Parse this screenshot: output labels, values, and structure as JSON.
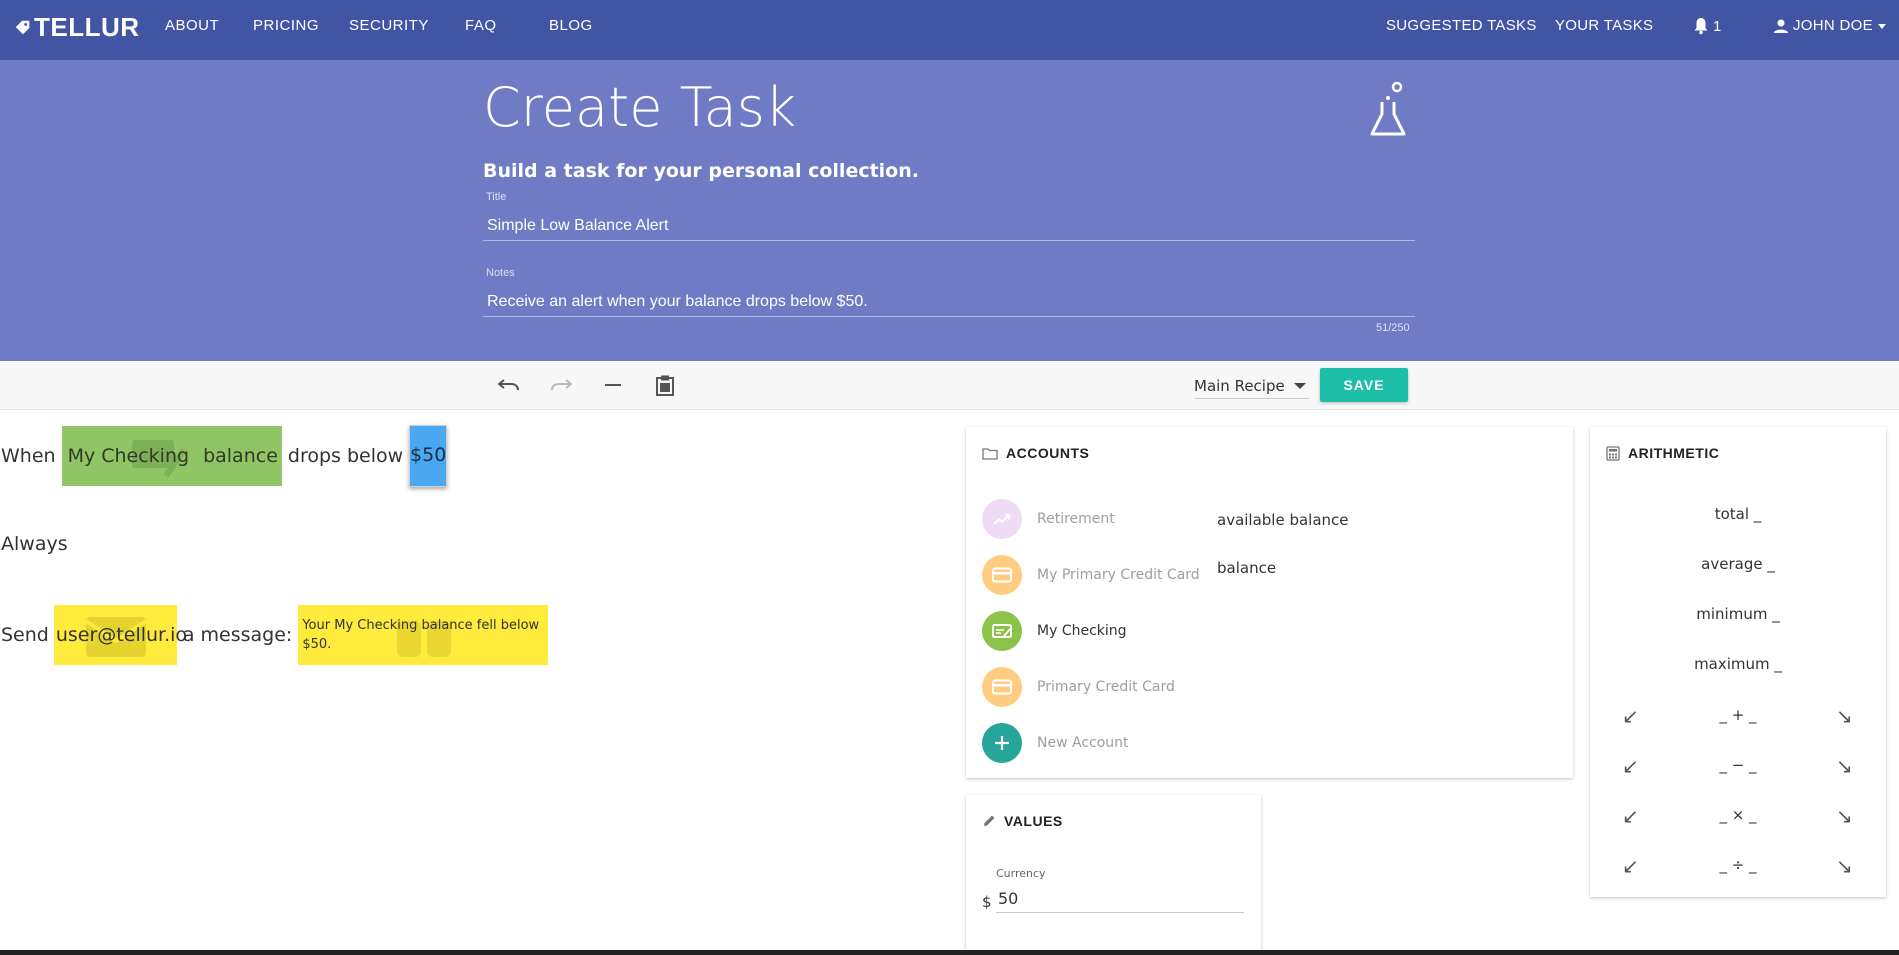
{
  "nav": {
    "brand": "TELLUR",
    "links": [
      "ABOUT",
      "PRICING",
      "SECURITY",
      "FAQ",
      "BLOG"
    ],
    "suggested_tasks": "SUGGESTED TASKS",
    "your_tasks": "YOUR TASKS",
    "notification_count": "1",
    "user_name": "JOHN DOE"
  },
  "header": {
    "title": "Create Task",
    "subtitle": "Build a task for your personal collection.",
    "title_label": "Title",
    "title_value": "Simple Low Balance Alert",
    "notes_label": "Notes",
    "notes_value": "Receive an alert when your balance drops below $50.",
    "char_counter": "51/250"
  },
  "toolbar": {
    "recipe_select": "Main Recipe",
    "save_label": "SAVE"
  },
  "recipe": {
    "line1": {
      "when": "When",
      "account": "My Checking",
      "property": "balance",
      "condition": "drops below",
      "amount": "$50"
    },
    "line2": {
      "always": "Always"
    },
    "line3": {
      "send": "Send",
      "email": "user@tellur.io",
      "a_message": "a message:",
      "message": "Your My Checking balance fell below $50."
    }
  },
  "accounts_panel": {
    "title": "ACCOUNTS",
    "items": [
      {
        "label": "Retirement",
        "icon": "trending-up-icon",
        "color": "#e8d5f0"
      },
      {
        "label": "My Primary Credit Card",
        "icon": "credit-card-icon",
        "color": "#ffcc80"
      },
      {
        "label": "My Checking",
        "icon": "checking-icon",
        "color": "#8bc34a"
      },
      {
        "label": "Primary Credit Card",
        "icon": "credit-card-icon",
        "color": "#ffcc80"
      },
      {
        "label": "New Account",
        "icon": "plus-icon",
        "color": "#26a69a"
      }
    ],
    "properties": [
      "available balance",
      "balance"
    ]
  },
  "values_panel": {
    "title": "VALUES",
    "currency_label": "Currency",
    "currency_symbol": "$",
    "currency_value": "50"
  },
  "arithmetic_panel": {
    "title": "ARITHMETIC",
    "functions": [
      "total _",
      "average _",
      "minimum _",
      "maximum _"
    ],
    "operators": [
      "_ + _",
      "_ − _",
      "_ × _",
      "_ ÷ _"
    ]
  },
  "colors": {
    "nav_bg": "#4254a4",
    "band_bg": "#6f7bc4",
    "save_bg": "#1dbfa8",
    "chip_green": "#8fc565",
    "chip_blue": "#4aa8f2",
    "chip_yellow": "#ffeb3b"
  }
}
